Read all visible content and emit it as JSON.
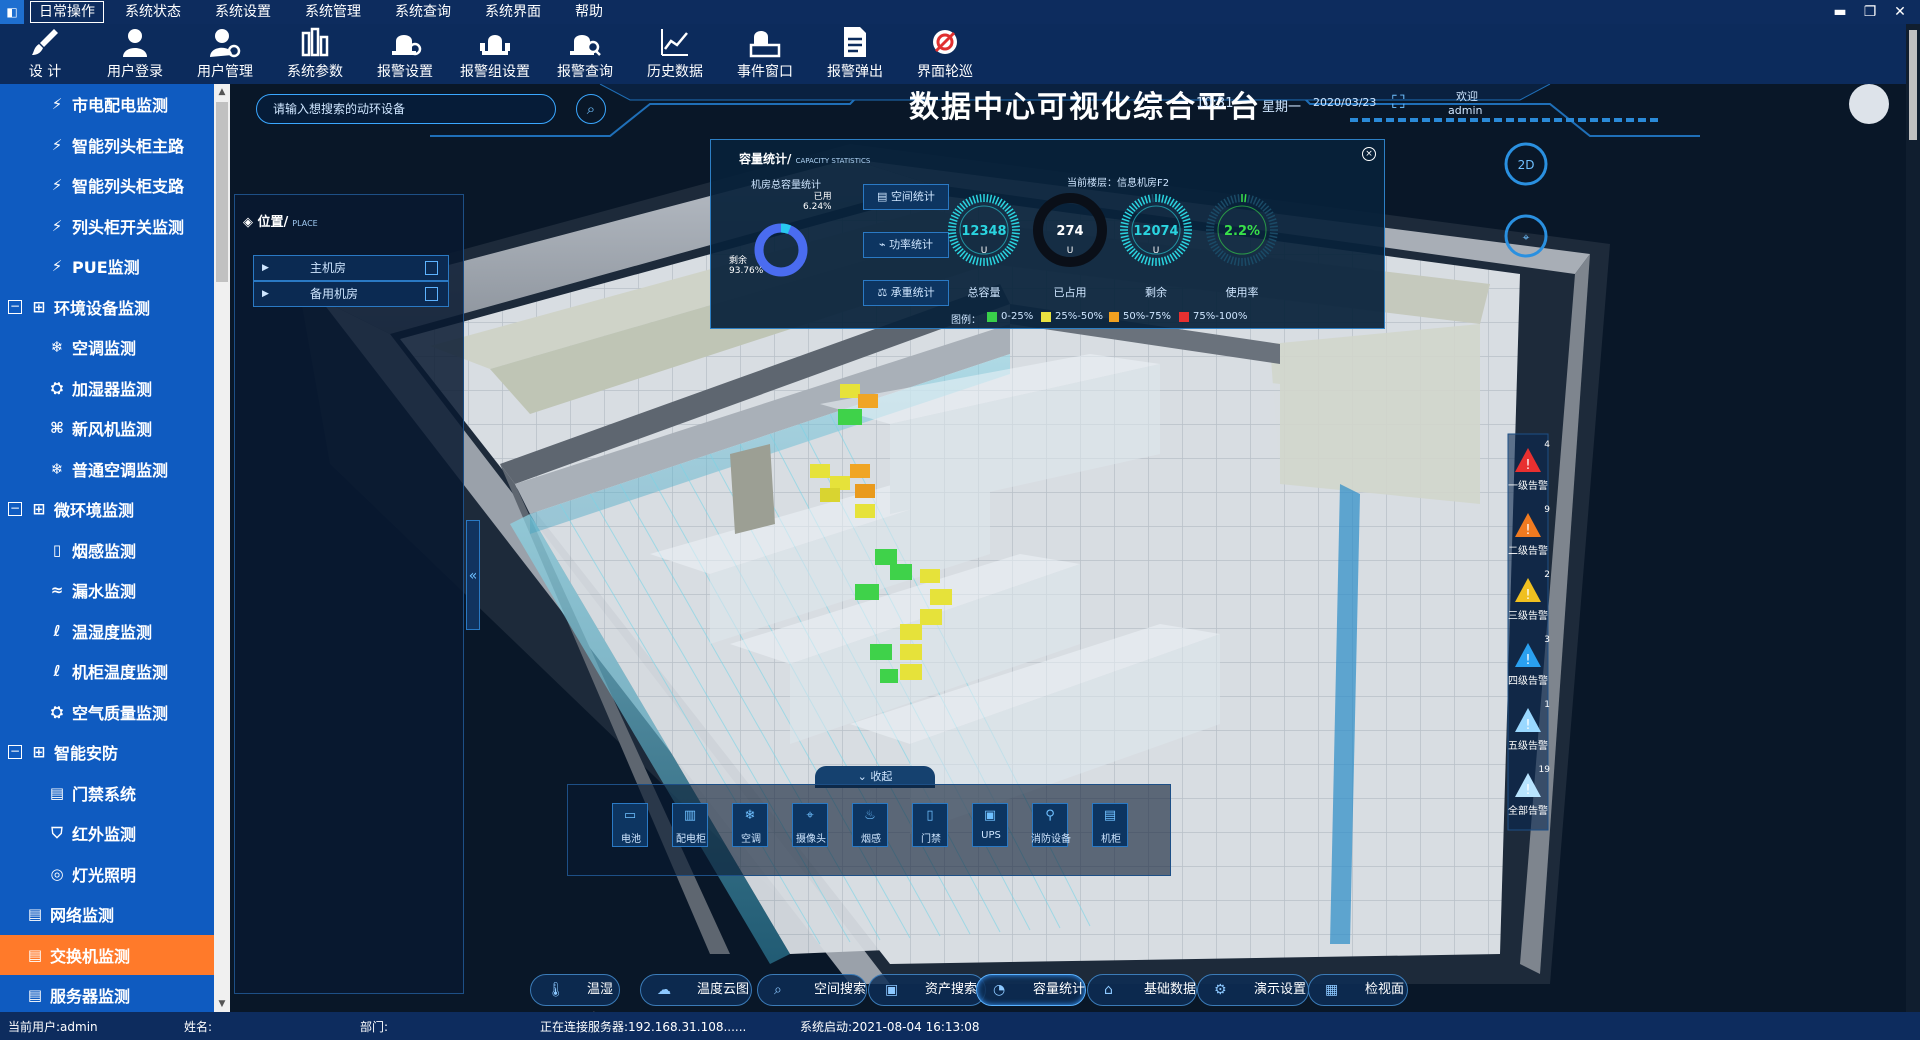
{
  "menubar": {
    "items": [
      "日常操作",
      "系统状态",
      "系统设置",
      "系统管理",
      "系统查询",
      "系统界面",
      "帮助"
    ],
    "controls": [
      "▬",
      "❐",
      "✕"
    ]
  },
  "toolbar": {
    "items": [
      "设 计",
      "用户登录",
      "用户管理",
      "系统参数",
      "报警设置",
      "报警组设置",
      "报警查询",
      "历史数据",
      "事件窗口",
      "报警弹出",
      "界面轮巡"
    ]
  },
  "sidebar": {
    "items": [
      {
        "label": "市电配电监测",
        "level": 2,
        "icon": "⚡"
      },
      {
        "label": "智能列头柜主路",
        "level": 2,
        "icon": "⚡"
      },
      {
        "label": "智能列头柜支路",
        "level": 2,
        "icon": "⚡"
      },
      {
        "label": "列头柜开关监测",
        "level": 2,
        "icon": "⚡"
      },
      {
        "label": "PUE监测",
        "level": 2,
        "icon": "⚡"
      },
      {
        "label": "环境设备监测",
        "level": 1,
        "icon": "⊞",
        "expand": "−"
      },
      {
        "label": "空调监测",
        "level": 2,
        "icon": "❄"
      },
      {
        "label": "加湿器监测",
        "level": 2,
        "icon": "⛭"
      },
      {
        "label": "新风机监测",
        "level": 2,
        "icon": "⌘"
      },
      {
        "label": "普通空调监测",
        "level": 2,
        "icon": "❄"
      },
      {
        "label": "微环境监测",
        "level": 1,
        "icon": "⊞",
        "expand": "−"
      },
      {
        "label": "烟感监测",
        "level": 2,
        "icon": "▯"
      },
      {
        "label": "漏水监测",
        "level": 2,
        "icon": "≈"
      },
      {
        "label": "温湿度监测",
        "level": 2,
        "icon": "ℓ"
      },
      {
        "label": "机柜温度监测",
        "level": 2,
        "icon": "ℓ"
      },
      {
        "label": "空气质量监测",
        "level": 2,
        "icon": "⛭"
      },
      {
        "label": "智能安防",
        "level": 1,
        "icon": "⊞",
        "expand": "−"
      },
      {
        "label": "门禁系统",
        "level": 2,
        "icon": "▤"
      },
      {
        "label": "红外监测",
        "level": 2,
        "icon": "⛉"
      },
      {
        "label": "灯光照明",
        "level": 2,
        "icon": "◎"
      },
      {
        "label": "网络监测",
        "level": 3,
        "icon": "▤"
      },
      {
        "label": "交换机监测",
        "level": 3,
        "icon": "▤",
        "selected": true
      },
      {
        "label": "服务器监测",
        "level": 3,
        "icon": "▤"
      }
    ]
  },
  "header": {
    "title": "数据中心可视化综合平台",
    "search_placeholder": "请输入想搜索的动环设备",
    "time": "10:31",
    "weekday": "星期一",
    "date": "2020/03/23",
    "welcome": "欢迎",
    "user": "admin"
  },
  "left_panel": {
    "title": "位置/",
    "title_en": "PLACE",
    "rows": [
      "主机房",
      "备用机房"
    ]
  },
  "capacity": {
    "title": "容量统计/",
    "title_en": "CAPACITY STATISTICS",
    "donut_title": "机房总容量统计",
    "used_label": "已用",
    "used_pct": "6.24%",
    "remain_label": "剩余",
    "remain_pct": "93.76%",
    "used_fraction": 0.0624,
    "buttons": [
      "空间统计",
      "功率统计",
      "承重统计"
    ],
    "floor": "当前楼层：信息机房F2",
    "gauges": [
      {
        "value": "12348",
        "unit": "U",
        "label": "总容量",
        "color": "#2ad4e0",
        "fill": 1.0
      },
      {
        "value": "274",
        "unit": "U",
        "label": "已占用",
        "color": "#ffffff",
        "fill": 0.022
      },
      {
        "value": "12074",
        "unit": "U",
        "label": "剩余",
        "color": "#2ad4e0",
        "fill": 0.978
      },
      {
        "value": "2.2%",
        "unit": "",
        "label": "使用率",
        "color": "#39e04a",
        "fill": 0.022
      }
    ],
    "legend_title": "图例：",
    "legend": [
      {
        "label": "0-25%",
        "color": "#39d04a"
      },
      {
        "label": "25%-50%",
        "color": "#e8e240"
      },
      {
        "label": "50%-75%",
        "color": "#f0a020"
      },
      {
        "label": "75%-100%",
        "color": "#e83030"
      }
    ]
  },
  "alarms": [
    {
      "label": "一级告警",
      "count": "4",
      "color": "#e83030"
    },
    {
      "label": "二级告警",
      "count": "9",
      "color": "#f07a20"
    },
    {
      "label": "三级告警",
      "count": "2",
      "color": "#f0c020"
    },
    {
      "label": "四级告警",
      "count": "3",
      "color": "#2aa0f0"
    },
    {
      "label": "五级告警",
      "count": "1",
      "color": "#9ad8ff"
    },
    {
      "label": "全部告警",
      "count": "19",
      "color": "#b8e4ff"
    }
  ],
  "dock": {
    "fold_label": "收起",
    "items": [
      "电池",
      "配电柜",
      "空调",
      "摄像头",
      "烟感",
      "门禁",
      "UPS",
      "消防设备",
      "机柜"
    ]
  },
  "bottom_nav": [
    {
      "label": "温湿度",
      "icon": "🌡"
    },
    {
      "label": "温度云图",
      "icon": "☁"
    },
    {
      "label": "空间搜索",
      "icon": "⌕"
    },
    {
      "label": "资产搜索",
      "icon": "▣"
    },
    {
      "label": "容量统计",
      "icon": "◔",
      "active": true
    },
    {
      "label": "基础数据",
      "icon": "⌂"
    },
    {
      "label": "演示设置",
      "icon": "⚙"
    },
    {
      "label": "检视面板",
      "icon": "▦"
    }
  ],
  "status": {
    "user": "当前用户:admin",
    "name": "姓名:",
    "dept": "部门:",
    "server": "正在连接服务器:192.168.31.108......",
    "start": "系统启动:2021-08-04 16:13:08"
  }
}
